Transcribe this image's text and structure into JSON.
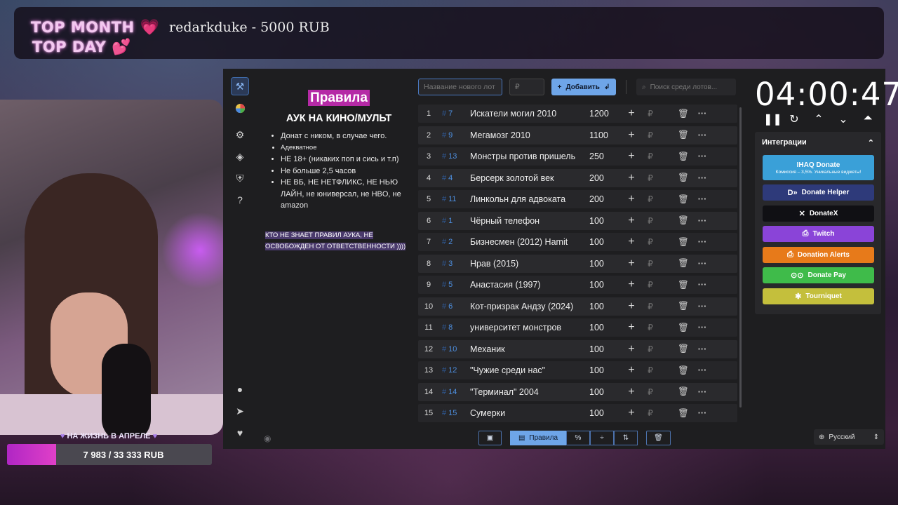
{
  "banner": {
    "top_month_label": "TOP MONTH",
    "top_month_value": "redarkduke - 5000 RUB",
    "top_day_label": "TOP DAY"
  },
  "goal": {
    "title": "НА ЖИЗНЬ В АПРЕЛЕ",
    "progress_text": "7 983 / 33 333 RUB",
    "progress_fraction": 0.2395
  },
  "rules": {
    "heading": "Правила",
    "subheading": "АУК НА КИНО/МУЛЬТ",
    "items": [
      "Донат с ником, в случае чего.",
      "Адекватное",
      "НЕ 18+ (никаких поп и сись и т.п)",
      "Не больше 2,5 часов",
      "НЕ ВБ, НЕ НЕТФЛИКС, НЕ НЬЮ ЛАЙН, не юниверсал, не HBO, не amazon"
    ],
    "warning": "КТО НЕ ЗНАЕТ ПРАВИЛ АУКА, НЕ ОСВОБОЖДЕН ОТ ОТВЕТСТВЕННОСТИ ))))"
  },
  "toolbar": {
    "name_placeholder": "Название нового лот",
    "amount_placeholder": "₽",
    "add_label": "Добавить",
    "search_placeholder": "Поиск среди лотов..."
  },
  "lots": [
    {
      "n": "1",
      "id": "7",
      "title": "Искатели могил 2010",
      "amount": "1200"
    },
    {
      "n": "2",
      "id": "9",
      "title": "Мегамозг 2010",
      "amount": "1100"
    },
    {
      "n": "3",
      "id": "13",
      "title": "Монстры против пришельцев",
      "amount": "250"
    },
    {
      "n": "4",
      "id": "4",
      "title": "Берсерк золотой век",
      "amount": "200"
    },
    {
      "n": "5",
      "id": "11",
      "title": "Линкольн для адвоката",
      "amount": "200"
    },
    {
      "n": "6",
      "id": "1",
      "title": "Чёрный телефон",
      "amount": "100"
    },
    {
      "n": "7",
      "id": "2",
      "title": "Бизнесмен (2012) Hamit",
      "amount": "100"
    },
    {
      "n": "8",
      "id": "3",
      "title": "Нрав (2015)",
      "amount": "100"
    },
    {
      "n": "9",
      "id": "5",
      "title": "Анастасия (1997)",
      "amount": "100"
    },
    {
      "n": "10",
      "id": "6",
      "title": "Кот-призрак Андзу (2024)",
      "amount": "100"
    },
    {
      "n": "11",
      "id": "8",
      "title": "университет монстров",
      "amount": "100"
    },
    {
      "n": "12",
      "id": "10",
      "title": "Механик",
      "amount": "100"
    },
    {
      "n": "13",
      "id": "12",
      "title": "\"Чужие среди нас\"",
      "amount": "100"
    },
    {
      "n": "14",
      "id": "14",
      "title": "\"Терминал\" 2004",
      "amount": "100"
    },
    {
      "n": "15",
      "id": "15",
      "title": "Сумерки",
      "amount": "100"
    }
  ],
  "bottom": {
    "rules_label": "Правила",
    "percent": "%"
  },
  "timer": {
    "value": "04:00:47"
  },
  "integrations": {
    "title": "Интеграции",
    "ihaq_label": "IHAQ Donate",
    "ihaq_sub": "Комиссия – 3,5%. Уникальные виджеты!",
    "buttons": [
      {
        "label": "Donate Helper",
        "color": "#2e3a7a"
      },
      {
        "label": "DonateX",
        "color": "#101014"
      },
      {
        "label": "Twitch",
        "color": "#8a44d8"
      },
      {
        "label": "Donation Alerts",
        "color": "#e77a1a"
      },
      {
        "label": "Donate Pay",
        "color": "#3fbb4a"
      },
      {
        "label": "Tourniquet",
        "color": "#c4bf3c"
      }
    ]
  },
  "language": {
    "value": "Русский"
  }
}
